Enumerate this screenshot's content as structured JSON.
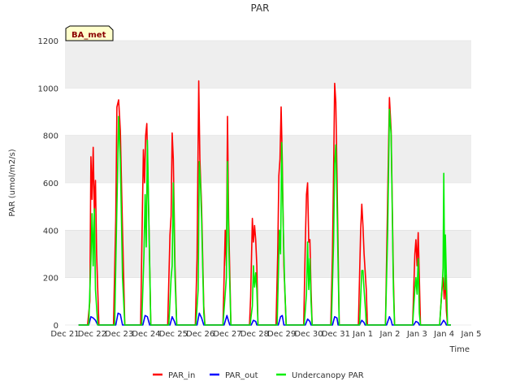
{
  "chart_data": {
    "type": "line",
    "title": "PAR",
    "xlabel": "Time",
    "ylabel": "PAR (umol/m2/s)",
    "badge": "BA_met",
    "ylim": [
      0,
      1200
    ],
    "yticks": [
      0,
      200,
      400,
      600,
      800,
      1000,
      1200
    ],
    "xlim": [
      "2020-12-21",
      "2021-01-05"
    ],
    "xticks": [
      "Dec 21",
      "Dec 22",
      "Dec 23",
      "Dec 24",
      "Dec 25",
      "Dec 26",
      "Dec 27",
      "Dec 28",
      "Dec 29",
      "Dec 30",
      "Dec 31",
      "Jan 1",
      "Jan 2",
      "Jan 3",
      "Jan 4",
      "Jan 5"
    ],
    "grid": true,
    "legend_position": "bottom",
    "colors": {
      "plot_band": "#eeeeee",
      "grid": "#ffffff"
    },
    "series": [
      {
        "name": "PAR_in",
        "color": "#ff0000",
        "points": [
          [
            "2020-12-21 12:00",
            0
          ],
          [
            "2020-12-21 20:00",
            0
          ],
          [
            "2020-12-21 22:00",
            100
          ],
          [
            "2020-12-21 23:00",
            710
          ],
          [
            "2020-12-22 00:00",
            530
          ],
          [
            "2020-12-22 01:00",
            750
          ],
          [
            "2020-12-22 02:00",
            480
          ],
          [
            "2020-12-22 03:00",
            610
          ],
          [
            "2020-12-22 04:00",
            300
          ],
          [
            "2020-12-22 06:00",
            0
          ],
          [
            "2020-12-22 19:00",
            0
          ],
          [
            "2020-12-22 21:00",
            450
          ],
          [
            "2020-12-22 22:00",
            920
          ],
          [
            "2020-12-22 23:30",
            950
          ],
          [
            "2020-12-23 01:00",
            820
          ],
          [
            "2020-12-23 03:00",
            400
          ],
          [
            "2020-12-23 05:00",
            0
          ],
          [
            "2020-12-23 19:00",
            0
          ],
          [
            "2020-12-23 20:30",
            450
          ],
          [
            "2020-12-23 21:30",
            740
          ],
          [
            "2020-12-23 22:30",
            600
          ],
          [
            "2020-12-23 23:30",
            800
          ],
          [
            "2020-12-24 00:30",
            850
          ],
          [
            "2020-12-24 02:00",
            500
          ],
          [
            "2020-12-24 04:00",
            0
          ],
          [
            "2020-12-24 19:00",
            0
          ],
          [
            "2020-12-24 21:00",
            380
          ],
          [
            "2020-12-24 22:00",
            460
          ],
          [
            "2020-12-24 23:00",
            810
          ],
          [
            "2020-12-25 00:00",
            700
          ],
          [
            "2020-12-25 01:30",
            250
          ],
          [
            "2020-12-25 03:00",
            0
          ],
          [
            "2020-12-25 19:30",
            0
          ],
          [
            "2020-12-25 21:00",
            280
          ],
          [
            "2020-12-25 22:30",
            1030
          ],
          [
            "2020-12-25 23:30",
            700
          ],
          [
            "2020-12-26 01:00",
            500
          ],
          [
            "2020-12-26 03:00",
            80
          ],
          [
            "2020-12-26 04:00",
            0
          ],
          [
            "2020-12-26 20:00",
            0
          ],
          [
            "2020-12-26 22:00",
            400
          ],
          [
            "2020-12-26 23:00",
            250
          ],
          [
            "2020-12-27 00:00",
            880
          ],
          [
            "2020-12-27 01:00",
            450
          ],
          [
            "2020-12-27 03:00",
            0
          ],
          [
            "2020-12-27 19:30",
            0
          ],
          [
            "2020-12-27 20:30",
            120
          ],
          [
            "2020-12-27 22:00",
            450
          ],
          [
            "2020-12-27 23:00",
            350
          ],
          [
            "2020-12-28 00:00",
            420
          ],
          [
            "2020-12-28 01:00",
            360
          ],
          [
            "2020-12-28 02:00",
            250
          ],
          [
            "2020-12-28 03:00",
            0
          ],
          [
            "2020-12-28 19:00",
            0
          ],
          [
            "2020-12-28 20:30",
            300
          ],
          [
            "2020-12-28 21:30",
            630
          ],
          [
            "2020-12-28 22:30",
            700
          ],
          [
            "2020-12-28 23:30",
            920
          ],
          [
            "2020-12-29 00:30",
            700
          ],
          [
            "2020-12-29 02:00",
            250
          ],
          [
            "2020-12-29 04:00",
            0
          ],
          [
            "2020-12-29 19:30",
            0
          ],
          [
            "2020-12-29 21:00",
            350
          ],
          [
            "2020-12-29 22:00",
            550
          ],
          [
            "2020-12-29 23:00",
            600
          ],
          [
            "2020-12-30 00:00",
            350
          ],
          [
            "2020-12-30 01:00",
            360
          ],
          [
            "2020-12-30 02:00",
            150
          ],
          [
            "2020-12-30 03:00",
            0
          ],
          [
            "2020-12-30 19:30",
            0
          ],
          [
            "2020-12-30 21:00",
            300
          ],
          [
            "2020-12-30 22:00",
            650
          ],
          [
            "2020-12-30 23:00",
            1020
          ],
          [
            "2020-12-31 00:00",
            940
          ],
          [
            "2020-12-31 01:00",
            650
          ],
          [
            "2020-12-31 03:00",
            0
          ],
          [
            "2020-12-31 20:00",
            0
          ],
          [
            "2020-12-31 22:00",
            400
          ],
          [
            "2020-12-31 23:00",
            510
          ],
          [
            "2021-01-01 00:00",
            420
          ],
          [
            "2021-01-01 01:00",
            300
          ],
          [
            "2021-01-01 03:00",
            150
          ],
          [
            "2021-01-01 04:00",
            0
          ],
          [
            "2021-01-01 20:00",
            0
          ],
          [
            "2021-01-01 22:00",
            550
          ],
          [
            "2021-01-01 23:30",
            960
          ],
          [
            "2021-01-02 01:00",
            820
          ],
          [
            "2021-01-02 03:00",
            200
          ],
          [
            "2021-01-02 04:00",
            0
          ],
          [
            "2021-01-02 20:00",
            0
          ],
          [
            "2021-01-02 22:00",
            300
          ],
          [
            "2021-01-02 23:00",
            360
          ],
          [
            "2021-01-03 00:00",
            250
          ],
          [
            "2021-01-03 01:00",
            390
          ],
          [
            "2021-01-03 02:00",
            200
          ],
          [
            "2021-01-03 03:00",
            0
          ],
          [
            "2021-01-03 20:00",
            0
          ],
          [
            "2021-01-03 22:00",
            150
          ],
          [
            "2021-01-03 23:00",
            200
          ],
          [
            "2021-01-04 00:00",
            110
          ],
          [
            "2021-01-04 01:00",
            210
          ],
          [
            "2021-01-04 02:00",
            60
          ],
          [
            "2021-01-04 03:00",
            0
          ],
          [
            "2021-01-04 06:00",
            0
          ]
        ]
      },
      {
        "name": "PAR_out",
        "color": "#0000ff",
        "points": [
          [
            "2020-12-21 12:00",
            0
          ],
          [
            "2020-12-21 21:00",
            0
          ],
          [
            "2020-12-21 23:00",
            35
          ],
          [
            "2020-12-22 01:00",
            30
          ],
          [
            "2020-12-22 03:00",
            20
          ],
          [
            "2020-12-22 05:00",
            0
          ],
          [
            "2020-12-22 21:00",
            0
          ],
          [
            "2020-12-22 23:00",
            50
          ],
          [
            "2020-12-23 01:00",
            45
          ],
          [
            "2020-12-23 03:00",
            0
          ],
          [
            "2020-12-23 21:00",
            0
          ],
          [
            "2020-12-23 23:00",
            40
          ],
          [
            "2020-12-24 01:00",
            35
          ],
          [
            "2020-12-24 03:00",
            0
          ],
          [
            "2020-12-24 21:00",
            0
          ],
          [
            "2020-12-24 23:00",
            35
          ],
          [
            "2020-12-25 01:00",
            15
          ],
          [
            "2020-12-25 02:00",
            0
          ],
          [
            "2020-12-25 21:00",
            0
          ],
          [
            "2020-12-25 23:00",
            50
          ],
          [
            "2020-12-26 01:00",
            30
          ],
          [
            "2020-12-26 03:00",
            0
          ],
          [
            "2020-12-26 21:00",
            0
          ],
          [
            "2020-12-26 23:30",
            40
          ],
          [
            "2020-12-27 01:00",
            15
          ],
          [
            "2020-12-27 02:00",
            0
          ],
          [
            "2020-12-27 21:00",
            0
          ],
          [
            "2020-12-27 23:00",
            20
          ],
          [
            "2020-12-28 01:00",
            15
          ],
          [
            "2020-12-28 02:00",
            0
          ],
          [
            "2020-12-28 21:00",
            0
          ],
          [
            "2020-12-28 23:00",
            35
          ],
          [
            "2020-12-29 00:30",
            40
          ],
          [
            "2020-12-29 02:00",
            0
          ],
          [
            "2020-12-29 21:00",
            0
          ],
          [
            "2020-12-29 23:00",
            25
          ],
          [
            "2020-12-30 01:00",
            15
          ],
          [
            "2020-12-30 02:00",
            0
          ],
          [
            "2020-12-30 21:00",
            0
          ],
          [
            "2020-12-30 23:00",
            35
          ],
          [
            "2020-12-31 01:00",
            30
          ],
          [
            "2020-12-31 02:00",
            0
          ],
          [
            "2020-12-31 21:00",
            0
          ],
          [
            "2020-12-31 23:00",
            20
          ],
          [
            "2021-01-01 01:00",
            10
          ],
          [
            "2021-01-01 02:00",
            0
          ],
          [
            "2021-01-01 21:00",
            0
          ],
          [
            "2021-01-01 23:30",
            35
          ],
          [
            "2021-01-02 01:00",
            20
          ],
          [
            "2021-01-02 02:00",
            0
          ],
          [
            "2021-01-02 21:00",
            0
          ],
          [
            "2021-01-02 23:00",
            15
          ],
          [
            "2021-01-03 01:00",
            10
          ],
          [
            "2021-01-03 02:00",
            0
          ],
          [
            "2021-01-03 21:00",
            0
          ],
          [
            "2021-01-03 23:30",
            20
          ],
          [
            "2021-01-04 01:00",
            10
          ],
          [
            "2021-01-04 02:00",
            0
          ],
          [
            "2021-01-04 06:00",
            0
          ]
        ]
      },
      {
        "name": "Undercanopy PAR",
        "color": "#00ee00",
        "points": [
          [
            "2020-12-21 12:00",
            0
          ],
          [
            "2020-12-21 21:00",
            0
          ],
          [
            "2020-12-21 23:00",
            280
          ],
          [
            "2020-12-22 00:00",
            470
          ],
          [
            "2020-12-22 01:00",
            250
          ],
          [
            "2020-12-22 02:00",
            490
          ],
          [
            "2020-12-22 03:00",
            150
          ],
          [
            "2020-12-22 05:00",
            0
          ],
          [
            "2020-12-22 20:00",
            0
          ],
          [
            "2020-12-22 22:00",
            500
          ],
          [
            "2020-12-22 23:30",
            880
          ],
          [
            "2020-12-23 01:00",
            700
          ],
          [
            "2020-12-23 03:00",
            200
          ],
          [
            "2020-12-23 05:00",
            0
          ],
          [
            "2020-12-23 20:00",
            0
          ],
          [
            "2020-12-23 22:00",
            300
          ],
          [
            "2020-12-23 23:00",
            550
          ],
          [
            "2020-12-24 00:00",
            330
          ],
          [
            "2020-12-24 01:00",
            780
          ],
          [
            "2020-12-24 02:30",
            400
          ],
          [
            "2020-12-24 04:00",
            0
          ],
          [
            "2020-12-24 20:00",
            0
          ],
          [
            "2020-12-24 22:00",
            200
          ],
          [
            "2020-12-24 23:00",
            250
          ],
          [
            "2020-12-25 00:00",
            600
          ],
          [
            "2020-12-25 01:30",
            200
          ],
          [
            "2020-12-25 03:00",
            0
          ],
          [
            "2020-12-25 20:00",
            0
          ],
          [
            "2020-12-25 22:00",
            150
          ],
          [
            "2020-12-25 23:00",
            690
          ],
          [
            "2020-12-26 00:00",
            600
          ],
          [
            "2020-12-26 01:00",
            450
          ],
          [
            "2020-12-26 03:00",
            50
          ],
          [
            "2020-12-26 04:00",
            0
          ],
          [
            "2020-12-26 20:00",
            0
          ],
          [
            "2020-12-26 22:00",
            130
          ],
          [
            "2020-12-26 23:00",
            200
          ],
          [
            "2020-12-27 00:00",
            690
          ],
          [
            "2020-12-27 01:00",
            350
          ],
          [
            "2020-12-27 03:00",
            0
          ],
          [
            "2020-12-27 20:00",
            0
          ],
          [
            "2020-12-27 22:00",
            80
          ],
          [
            "2020-12-27 23:00",
            250
          ],
          [
            "2020-12-28 00:00",
            160
          ],
          [
            "2020-12-28 01:00",
            220
          ],
          [
            "2020-12-28 02:00",
            150
          ],
          [
            "2020-12-28 03:00",
            0
          ],
          [
            "2020-12-28 20:00",
            0
          ],
          [
            "2020-12-28 22:00",
            400
          ],
          [
            "2020-12-28 23:00",
            300
          ],
          [
            "2020-12-29 00:00",
            770
          ],
          [
            "2020-12-29 01:00",
            500
          ],
          [
            "2020-12-29 02:30",
            200
          ],
          [
            "2020-12-29 04:00",
            0
          ],
          [
            "2020-12-29 20:00",
            0
          ],
          [
            "2020-12-29 22:00",
            130
          ],
          [
            "2020-12-29 23:00",
            350
          ],
          [
            "2020-12-30 00:00",
            150
          ],
          [
            "2020-12-30 01:00",
            280
          ],
          [
            "2020-12-30 02:00",
            100
          ],
          [
            "2020-12-30 03:00",
            0
          ],
          [
            "2020-12-30 20:00",
            0
          ],
          [
            "2020-12-30 22:00",
            350
          ],
          [
            "2020-12-30 23:00",
            680
          ],
          [
            "2020-12-31 00:00",
            760
          ],
          [
            "2020-12-31 01:00",
            520
          ],
          [
            "2020-12-31 03:00",
            0
          ],
          [
            "2020-12-31 21:00",
            0
          ],
          [
            "2020-12-31 23:00",
            230
          ],
          [
            "2021-01-01 00:00",
            230
          ],
          [
            "2021-01-01 01:00",
            150
          ],
          [
            "2021-01-01 02:30",
            50
          ],
          [
            "2021-01-01 03:00",
            0
          ],
          [
            "2021-01-01 20:00",
            0
          ],
          [
            "2021-01-01 22:00",
            400
          ],
          [
            "2021-01-01 23:30",
            910
          ],
          [
            "2021-01-02 01:00",
            800
          ],
          [
            "2021-01-02 03:00",
            150
          ],
          [
            "2021-01-02 04:00",
            0
          ],
          [
            "2021-01-02 20:00",
            0
          ],
          [
            "2021-01-02 22:00",
            150
          ],
          [
            "2021-01-02 23:00",
            200
          ],
          [
            "2021-01-03 00:00",
            130
          ],
          [
            "2021-01-03 01:00",
            280
          ],
          [
            "2021-01-03 02:00",
            50
          ],
          [
            "2021-01-03 03:00",
            0
          ],
          [
            "2021-01-03 20:00",
            0
          ],
          [
            "2021-01-03 22:00",
            150
          ],
          [
            "2021-01-03 23:00",
            240
          ],
          [
            "2021-01-03 23:40",
            640
          ],
          [
            "2021-01-04 00:30",
            150
          ],
          [
            "2021-01-04 01:00",
            380
          ],
          [
            "2021-01-04 02:00",
            200
          ],
          [
            "2021-01-04 03:00",
            0
          ],
          [
            "2021-01-04 06:00",
            0
          ]
        ]
      }
    ]
  }
}
